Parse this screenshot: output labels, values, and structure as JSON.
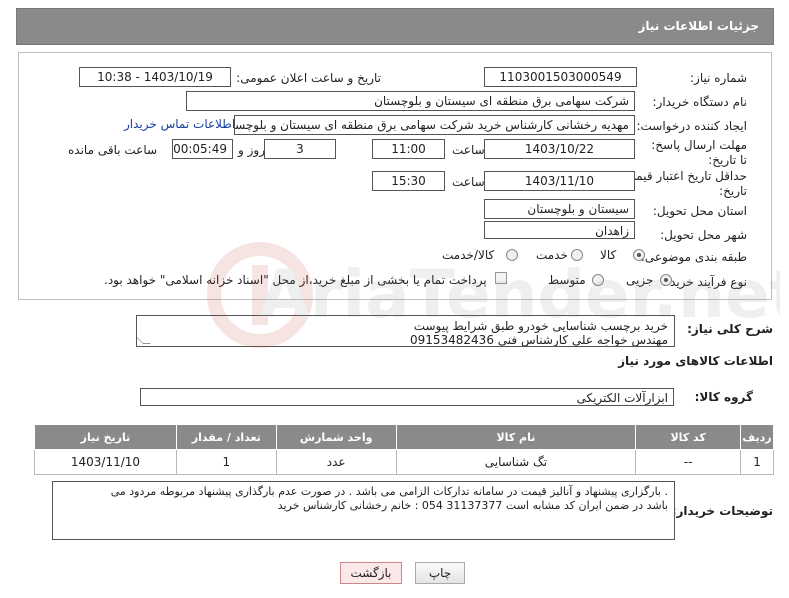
{
  "header": {
    "title": "جزئیات اطلاعات نیاز"
  },
  "need_number": {
    "label": "شماره نیاز:",
    "value": "1103001503000549"
  },
  "announce": {
    "label": "تاریخ و ساعت اعلان عمومی:",
    "value": "1403/10/19 - 10:38"
  },
  "buyer_org": {
    "label": "نام دستگاه خریدار:",
    "value": "شرکت سهامی برق منطقه ای سیستان و بلوچستان"
  },
  "requester": {
    "label": "ایجاد کننده درخواست:",
    "value": "مهدیه رخشانی کارشناس خرید شرکت سهامی برق منطقه ای سیستان و بلوچستان",
    "contact_link": "اطلاعات تماس خریدار"
  },
  "deadline": {
    "label": "مهلت ارسال پاسخ: تا تاریخ:",
    "date": "1403/10/22",
    "time_label": "ساعت",
    "time": "11:00",
    "days": "3",
    "days_label": "روز و",
    "remaining": "00:05:49",
    "remaining_label": "ساعت باقی مانده"
  },
  "validity": {
    "label": "حداقل تاریخ اعتبار قیمت: تا تاریخ:",
    "date": "1403/11/10",
    "time_label": "ساعت",
    "time": "15:30"
  },
  "province": {
    "label": "استان محل تحویل:",
    "value": "سیستان و بلوچستان"
  },
  "city": {
    "label": "شهر محل تحویل:",
    "value": "زاهدان"
  },
  "category": {
    "label": "طبقه بندی موضوعی:",
    "options": [
      "کالا",
      "خدمت",
      "کالا/خدمت"
    ],
    "selected": "کالا"
  },
  "purchase_type": {
    "label": "نوع فرآیند خرید :",
    "options": [
      "جزیی",
      "متوسط"
    ],
    "selected": "جزیی",
    "note": "پرداخت تمام یا بخشی از مبلغ خرید،از محل \"اسناد خزانه اسلامی\" خواهد بود."
  },
  "description": {
    "label": "شرح کلی نیاز:",
    "line1": "خرید برچسب شناسایی خودرو طبق شرایط پیوست",
    "line2": "مهندس خواجه علی کارشناس فنی 09153482436"
  },
  "goods_section": {
    "title": "اطلاعات کالاهای مورد نیاز"
  },
  "goods_group": {
    "label": "گروه کالا:",
    "value": "ابزارآلات الکتریکی"
  },
  "table": {
    "headers": [
      "ردیف",
      "کد کالا",
      "نام کالا",
      "واحد شمارش",
      "تعداد / مقدار",
      "تاریخ نیاز"
    ],
    "rows": [
      {
        "row": "1",
        "code": "--",
        "name": "تگ شناسایی",
        "unit": "عدد",
        "qty": "1",
        "date": "1403/11/10"
      }
    ]
  },
  "buyer_notes": {
    "label": "توضیحات خریدار:",
    "line1": ". بارگزاری پیشنهاد و آنالیز قیمت در سامانه تدارکات الزامی می باشد . در صورت عدم بارگذاری پیشنهاد مربوطه مردود می",
    "line2": "باشد در ضمن ایران کد مشابه است 31137377 054 : خانم رخشانی کارشناس خرید"
  },
  "buttons": {
    "print": "چاپ",
    "back": "بازگشت"
  },
  "watermark": {
    "text": "AriaTender.net"
  }
}
